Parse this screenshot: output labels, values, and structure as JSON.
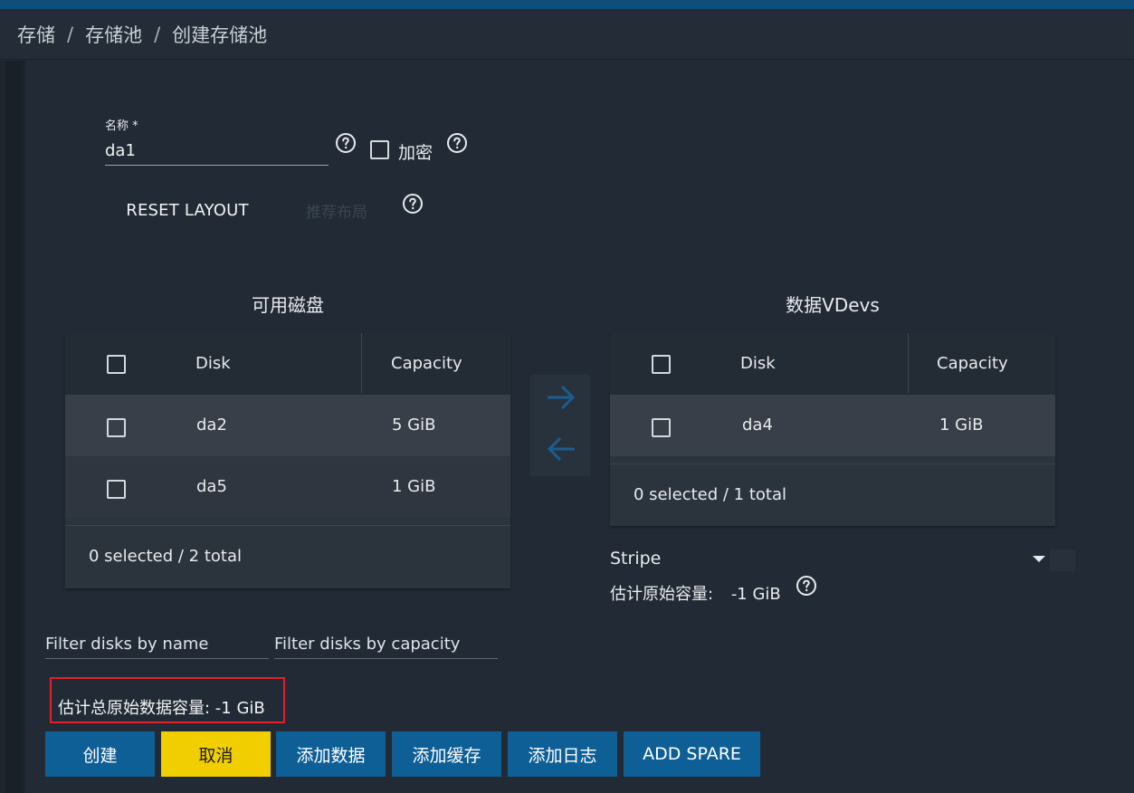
{
  "breadcrumb": [
    "存储",
    "存储池",
    "创建存储池"
  ],
  "form": {
    "name_label": "名称 *",
    "name_value": "da1",
    "encrypt_label": "加密",
    "reset_layout_label": "RESET LAYOUT",
    "suggest_layout_label": "推荐布局"
  },
  "available_disks": {
    "title": "可用磁盘",
    "columns": [
      "Disk",
      "Capacity"
    ],
    "rows": [
      {
        "disk": "da2",
        "capacity": "5 GiB"
      },
      {
        "disk": "da5",
        "capacity": "1 GiB"
      }
    ],
    "footer": "0 selected / 2 total"
  },
  "data_vdevs": {
    "title": "数据VDevs",
    "columns": [
      "Disk",
      "Capacity"
    ],
    "rows": [
      {
        "disk": "da4",
        "capacity": "1 GiB"
      }
    ],
    "footer": "0 selected / 1 total",
    "layout_value": "Stripe",
    "estimated_label": "估计原始容量:",
    "estimated_value": "-1 GiB"
  },
  "filters": {
    "name_placeholder": "Filter disks by name",
    "capacity_placeholder": "Filter disks by capacity"
  },
  "estimated_total": "估计总原始数据容量: -1 GiB",
  "buttons": {
    "create": "创建",
    "cancel": "取消",
    "add_data": "添加数据",
    "add_cache": "添加缓存",
    "add_log": "添加日志",
    "add_spare": "ADD SPARE"
  },
  "colors": {
    "primary": "#0e5f96",
    "cancel": "#f0ce00",
    "highlight_border": "#e3202a"
  }
}
